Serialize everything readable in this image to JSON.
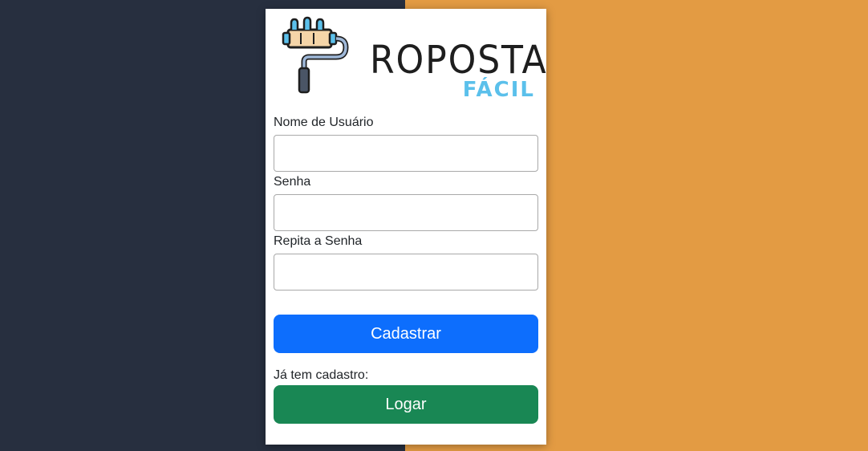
{
  "colors": {
    "background_left": "#272f3f",
    "background_right": "#e39b43",
    "primary_button": "#0d6efd",
    "success_button": "#198754",
    "logo_accent": "#5bc0eb"
  },
  "logo": {
    "icon": "paint-roller-icon",
    "word": "ROPOSTA",
    "sub": "FÁCIL"
  },
  "form": {
    "username": {
      "label": "Nome de Usuário",
      "value": "",
      "placeholder": ""
    },
    "password": {
      "label": "Senha",
      "value": "",
      "placeholder": ""
    },
    "repeat_password": {
      "label": "Repita a Senha",
      "value": "",
      "placeholder": ""
    },
    "submit_label": "Cadastrar"
  },
  "login": {
    "question": "Já tem cadastro:",
    "button_label": "Logar"
  }
}
